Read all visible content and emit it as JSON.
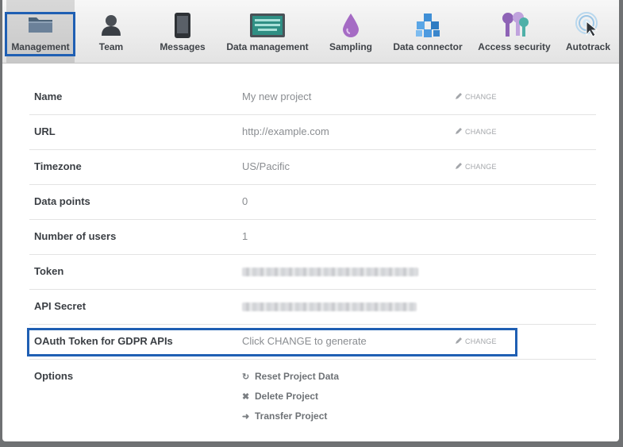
{
  "nav": {
    "tabs": [
      {
        "label": "Management",
        "icon": "folder-icon",
        "active": true
      },
      {
        "label": "Team",
        "icon": "person-icon"
      },
      {
        "label": "Messages",
        "icon": "phone-icon"
      },
      {
        "label": "Data management",
        "icon": "keyboard-icon"
      },
      {
        "label": "Sampling",
        "icon": "droplet-icon"
      },
      {
        "label": "Data connector",
        "icon": "cubes-icon"
      },
      {
        "label": "Access security",
        "icon": "keys-icon"
      },
      {
        "label": "Autotrack",
        "icon": "cursor-target-icon"
      }
    ]
  },
  "settings": {
    "change_label": "CHANGE",
    "rows": [
      {
        "label": "Name",
        "value": "My new project"
      },
      {
        "label": "URL",
        "value": "http://example.com"
      },
      {
        "label": "Timezone",
        "value": "US/Pacific"
      },
      {
        "label": "Data points",
        "value": "0"
      },
      {
        "label": "Number of users",
        "value": "1"
      },
      {
        "label": "Token",
        "value": ""
      },
      {
        "label": "API Secret",
        "value": ""
      },
      {
        "label": "OAuth Token for GDPR APIs",
        "value": "Click CHANGE to generate"
      },
      {
        "label": "Options",
        "value": ""
      }
    ],
    "options": [
      {
        "label": "Reset Project Data",
        "icon": "reset-icon"
      },
      {
        "label": "Delete Project",
        "icon": "delete-icon"
      },
      {
        "label": "Transfer Project",
        "icon": "arrow-right-icon"
      }
    ]
  },
  "colors": {
    "highlight": "#1f5fb3",
    "background": "#6f7173"
  }
}
